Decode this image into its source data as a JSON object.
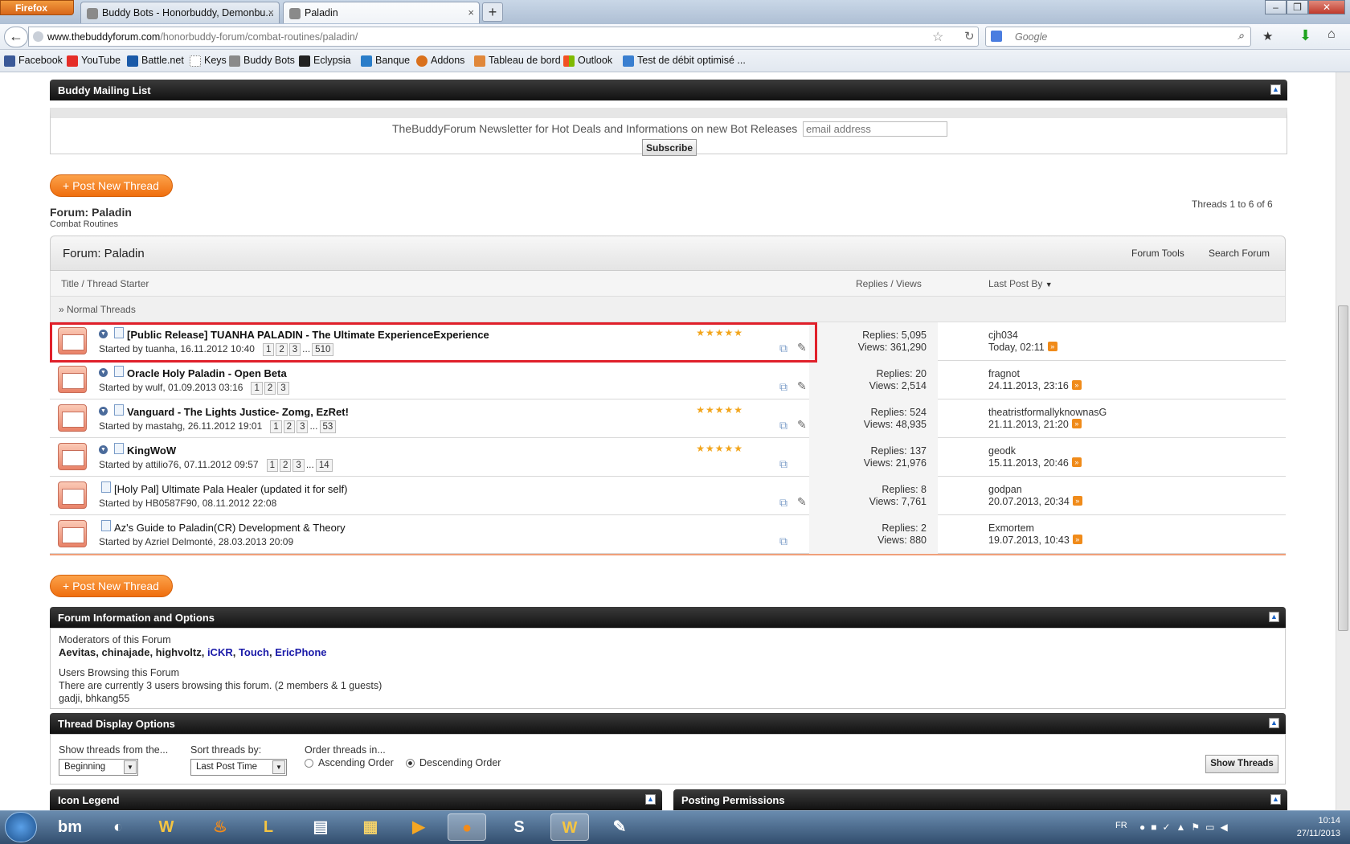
{
  "browser": {
    "menu_button": "Firefox",
    "tabs": [
      {
        "label": "Buddy Bots - Honorbuddy, Demonbu...",
        "close": "×"
      },
      {
        "label": "Paladin",
        "close": "×"
      }
    ],
    "new_tab": "+",
    "url_domain": "www.thebuddyforum.com",
    "url_path": "/honorbuddy-forum/combat-routines/paladin/",
    "search_placeholder": "Google",
    "window_buttons": [
      "‒",
      "❐",
      "✕"
    ]
  },
  "bookmarks": [
    {
      "label": "Facebook",
      "color": "#3b5998"
    },
    {
      "label": "YouTube",
      "color": "#e52d27"
    },
    {
      "label": "Battle.net",
      "color": "#1b5aa8"
    },
    {
      "label": "Keys",
      "color": "#dddddd"
    },
    {
      "label": "Buddy Bots",
      "color": "#8a8a8a"
    },
    {
      "label": "Eclypsia",
      "color": "#222222"
    },
    {
      "label": "Banque",
      "color": "#2a7dc9"
    },
    {
      "label": "Addons",
      "color": "#d9701c"
    },
    {
      "label": "Tableau de bord",
      "color": "#e0873a"
    },
    {
      "label": "Outlook",
      "color": "#f25022"
    },
    {
      "label": "Test de débit optimisé ...",
      "color": "#3a7fd0"
    }
  ],
  "mailing": {
    "header": "Buddy Mailing List",
    "text": "TheBuddyForum Newsletter for Hot Deals and Informations on new Bot Releases",
    "email_placeholder": "email address",
    "subscribe": "Subscribe"
  },
  "post_new_thread": "+ Post New Thread",
  "forum": {
    "title": "Forum: Paladin",
    "subtitle": "Combat Routines",
    "threads_count": "Threads 1 to 6 of 6",
    "header_title": "Forum: Paladin",
    "tools": "Forum Tools",
    "search": "Search Forum",
    "col_title": "Title / Thread Starter",
    "col_replies": "Replies / Views",
    "col_last": "Last Post By",
    "normal_threads": "» Normal Threads"
  },
  "threads": [
    {
      "title": "[Public Release] TUANHA PALADIN - The Ultimate ExperienceExperience",
      "bold": true,
      "started": "Started by tuanha, 16.11.2012 10:40",
      "pages": [
        "1",
        "2",
        "3",
        "...",
        "510"
      ],
      "rating": 5,
      "replies": "Replies: 5,095",
      "views": "Views: 361,290",
      "last_user": "cjh034",
      "last_time": "Today, 02:11"
    },
    {
      "title": "Oracle Holy Paladin - Open Beta",
      "bold": true,
      "started": "Started by wulf, 01.09.2013 03:16",
      "pages": [
        "1",
        "2",
        "3"
      ],
      "rating": 0,
      "replies": "Replies: 20",
      "views": "Views: 2,514",
      "last_user": "fragnot",
      "last_time": "24.11.2013, 23:16"
    },
    {
      "title": "Vanguard - The Lights Justice- Zomg, EzRet!",
      "bold": true,
      "started": "Started by mastahg, 26.11.2012 19:01",
      "pages": [
        "1",
        "2",
        "3",
        "...",
        "53"
      ],
      "rating": 5,
      "replies": "Replies: 524",
      "views": "Views: 48,935",
      "last_user": "theatristformallyknownasG",
      "last_time": "21.11.2013, 21:20"
    },
    {
      "title": "KingWoW",
      "bold": true,
      "started": "Started by attilio76, 07.11.2012 09:57",
      "pages": [
        "1",
        "2",
        "3",
        "...",
        "14"
      ],
      "rating": 5,
      "replies": "Replies: 137",
      "views": "Views: 21,976",
      "last_user": "geodk",
      "last_time": "15.11.2013, 20:46"
    },
    {
      "title": "[Holy Pal] Ultimate Pala Healer (updated it for self)",
      "bold": false,
      "started": "Started by HB0587F90, 08.11.2012 22:08",
      "pages": [],
      "rating": 0,
      "replies": "Replies: 8",
      "views": "Views: 7,761",
      "last_user": "godpan",
      "last_time": "20.07.2013, 20:34"
    },
    {
      "title": "Az's Guide to Paladin(CR) Development & Theory",
      "bold": false,
      "started": "Started by Azriel Delmonté, 28.03.2013 20:09",
      "pages": [],
      "rating": 0,
      "replies": "Replies: 2",
      "views": "Views: 880",
      "last_user": "Exmortem",
      "last_time": "19.07.2013, 10:43"
    }
  ],
  "info": {
    "header": "Forum Information and Options",
    "mods_label": "Moderators of this Forum",
    "mods_plain": "Aevitas, chinajade, highvoltz, ",
    "mods_blue": [
      "iCKR",
      "Touch",
      "EricPhone"
    ],
    "sep": ", ",
    "browsing_label": "Users Browsing this Forum",
    "browsing_text": "There are currently 3 users browsing this forum. (2 members & 1 guests)",
    "browsing_users": "gadji, bhkang55"
  },
  "display": {
    "header": "Thread Display Options",
    "show_from_label": "Show threads from the...",
    "show_from_value": "Beginning",
    "sort_label": "Sort threads by:",
    "sort_value": "Last Post Time",
    "order_label": "Order threads in...",
    "asc": "Ascending Order",
    "desc": "Descending Order",
    "show_btn": "Show Threads"
  },
  "legend_header": "Icon Legend",
  "perms_header": "Posting Permissions",
  "taskbar": {
    "lang": "FR",
    "time": "10:14",
    "date": "27/11/2013"
  },
  "colors": {
    "accent": "#ef6e0e",
    "highlight": "#e0202a",
    "link": "#1a1aa8"
  }
}
